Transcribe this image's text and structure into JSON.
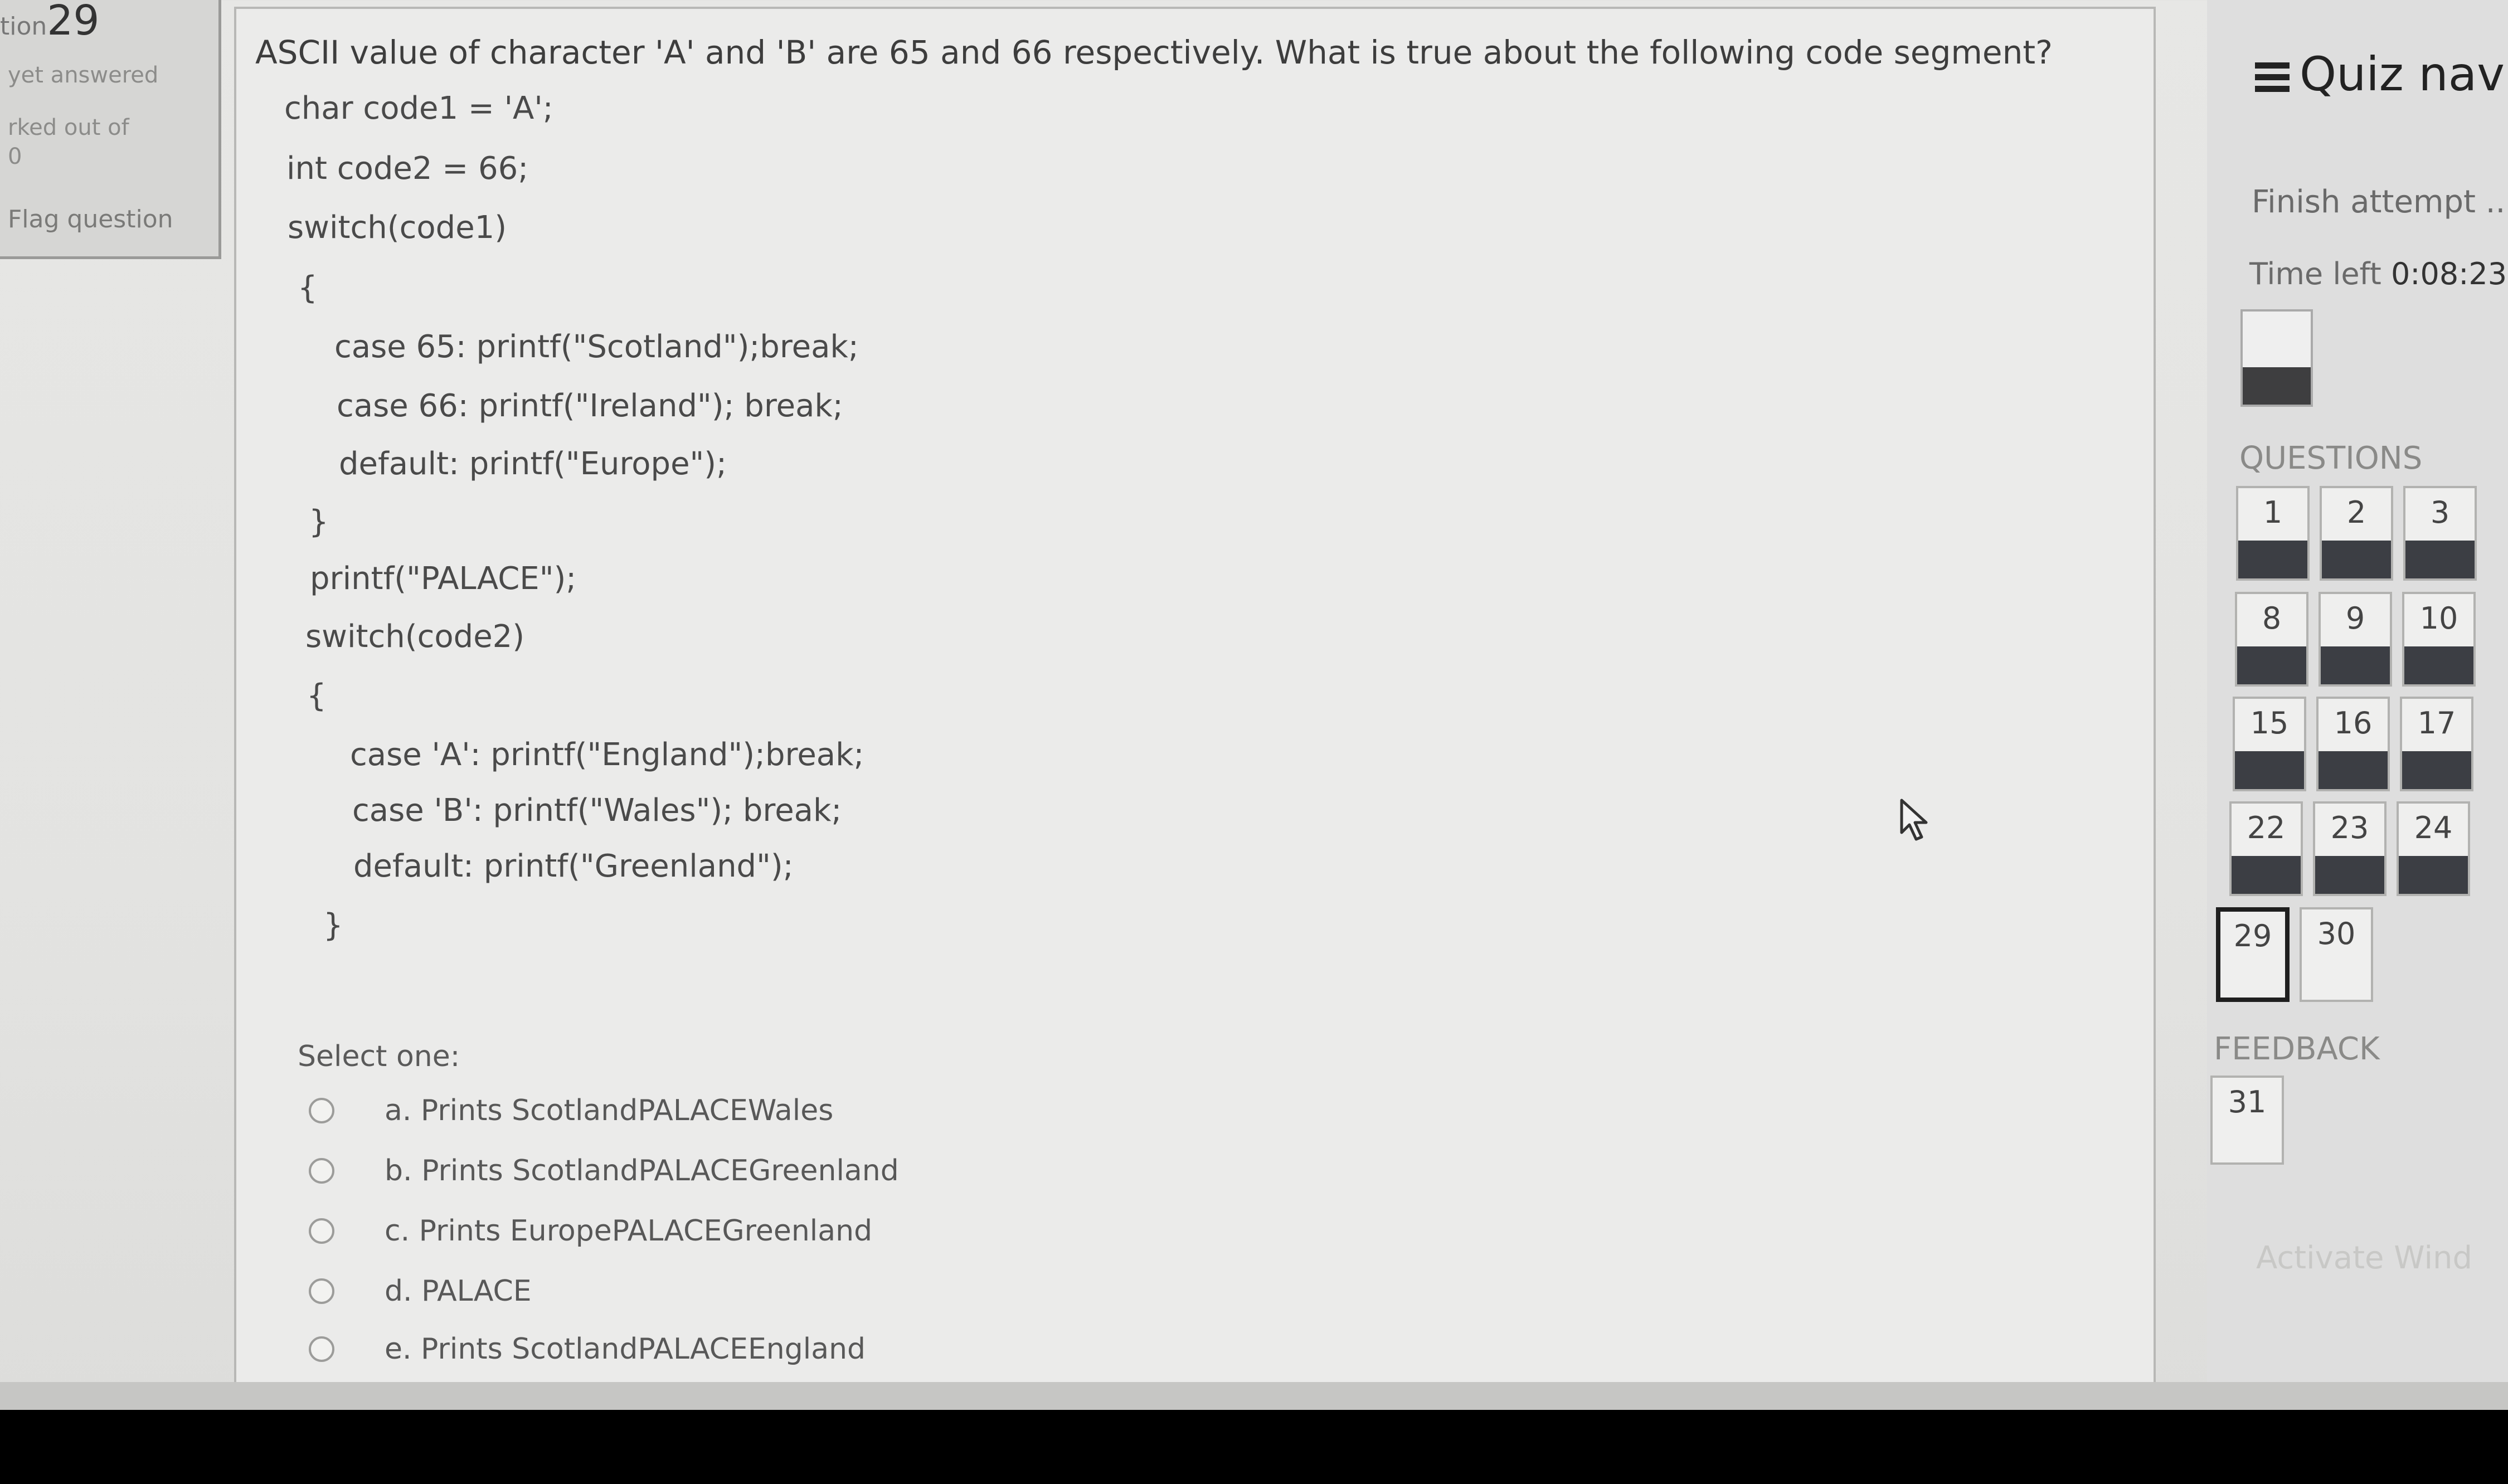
{
  "question_info": {
    "prefix": "tion",
    "number": "29",
    "status": "yet answered",
    "marks": "rked out of",
    "marks_value": "0",
    "flag_label": "Flag question"
  },
  "question": {
    "text": "ASCII value of character 'A' and 'B' are 65 and 66 respectively. What is true about the following code segment?",
    "code_lines": [
      "char code1 = 'A';",
      "int code2 = 66;",
      "switch(code1)",
      "{",
      "case 65: printf(\"Scotland\");break;",
      "case 66: printf(\"Ireland\"); break;",
      "default: printf(\"Europe\");",
      "}",
      "printf(\"PALACE\");",
      "switch(code2)",
      "{",
      "case 'A': printf(\"England\");break;",
      "case 'B': printf(\"Wales\"); break;",
      "default: printf(\"Greenland\");",
      "}"
    ],
    "select_label": "Select one:",
    "options": [
      "a. Prints  ScotlandPALACEWales",
      "b. Prints  ScotlandPALACEGreenland",
      "c. Prints  EuropePALACEGreenland",
      "d. PALACE",
      "e. Prints  ScotlandPALACEEngland"
    ]
  },
  "nav": {
    "title": "Quiz navig",
    "finish_link": "Finish attempt ...",
    "time_label": "Time left",
    "time_value": "0:08:23",
    "progress_label": "i",
    "progress_fraction": 0.4,
    "questions_heading": "QUESTIONS",
    "question_buttons": [
      "1",
      "2",
      "3",
      "8",
      "9",
      "10",
      "15",
      "16",
      "17",
      "22",
      "23",
      "24",
      "29",
      "30"
    ],
    "current_question": "29",
    "feedback_heading": "FEEDBACK",
    "feedback_buttons": [
      "31"
    ],
    "watermark": "Activate Wind"
  },
  "icons": {
    "menu": "hamburger-menu-icon",
    "cursor": "mouse-pointer-icon"
  }
}
